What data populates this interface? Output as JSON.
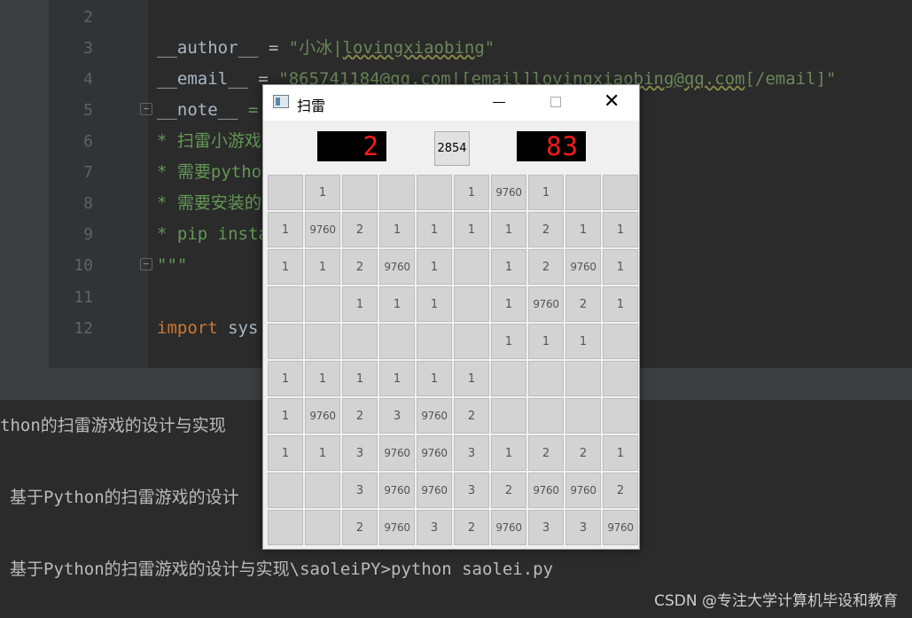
{
  "editor": {
    "line_numbers": [
      "2",
      "3",
      "4",
      "5",
      "6",
      "7",
      "8",
      "9",
      "10",
      "11",
      "12"
    ],
    "lines": {
      "author_var": "__author__",
      "author_eq": " = ",
      "author_val_pre": "\"小冰|",
      "author_val_link": "lovingxiaobing",
      "author_val_post": "\"",
      "email_var": "__email__",
      "email_eq": " = ",
      "email_val_pre": "\"865741184@qq.com|[email]",
      "email_val_link": "lovingxiaobing@qq.com",
      "email_val_post": "[/email]\"",
      "note_var": "__note__",
      "note_eq": " = \"\"\"",
      "doc1": "* 扫雷小游戏",
      "doc2": "* 需要python",
      "doc3": "* 需要安装的",
      "doc4": "* pip insta",
      "doc_end": "\"\"\"",
      "import_kw": "import",
      "import_mod": " sys"
    }
  },
  "terminal": {
    "line1": "thon的扫雷游戏的设计与实现",
    "line2": "基于Python的扫雷游戏的设计",
    "line3": "基于Python的扫雷游戏的设计与实现\\saoleiPY>python saolei.py"
  },
  "watermark": "CSDN @专注大学计算机毕设和教育",
  "window": {
    "title": "扫雷",
    "mine_counter": "2",
    "center_button": "2854",
    "timer": "83",
    "grid": [
      [
        "",
        "1",
        "",
        "",
        "",
        "1",
        "9760",
        "1",
        "",
        ""
      ],
      [
        "1",
        "9760",
        "2",
        "1",
        "1",
        "1",
        "1",
        "2",
        "1",
        "1"
      ],
      [
        "1",
        "1",
        "2",
        "9760",
        "1",
        "",
        "1",
        "2",
        "9760",
        "1"
      ],
      [
        "",
        "",
        "1",
        "1",
        "1",
        "",
        "1",
        "9760",
        "2",
        "1"
      ],
      [
        "",
        "",
        "",
        "",
        "",
        "",
        "1",
        "1",
        "1",
        ""
      ],
      [
        "1",
        "1",
        "1",
        "1",
        "1",
        "1",
        "",
        "",
        "",
        ""
      ],
      [
        "1",
        "9760",
        "2",
        "3",
        "9760",
        "2",
        "",
        "",
        "",
        ""
      ],
      [
        "1",
        "1",
        "3",
        "9760",
        "9760",
        "3",
        "1",
        "2",
        "2",
        "1"
      ],
      [
        "",
        "",
        "3",
        "9760",
        "9760",
        "3",
        "2",
        "9760",
        "9760",
        "2"
      ],
      [
        "",
        "",
        "2",
        "9760",
        "3",
        "2",
        "9760",
        "3",
        "3",
        "9760"
      ]
    ]
  }
}
